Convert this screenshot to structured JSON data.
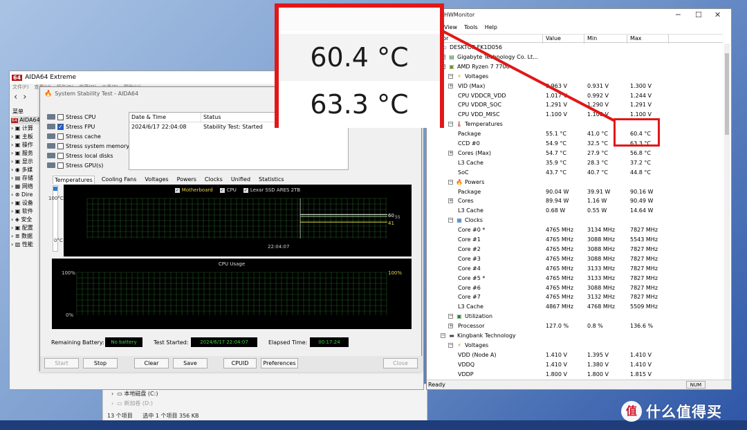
{
  "aida": {
    "title": "AIDA64 Extreme",
    "logo": "64",
    "menu": [
      "文件(F)",
      "查看(V)",
      "报告(R)",
      "收藏(O)",
      "工具(T)",
      "帮助(H)"
    ],
    "sidebar_header": "菜单",
    "tree_root": "AIDA64",
    "tree_items": [
      "计算",
      "主板",
      "操作",
      "服务",
      "显示",
      "多媒",
      "存储",
      "网络",
      "Dire",
      "设备",
      "软件",
      "安全",
      "配置",
      "数据",
      "性能"
    ]
  },
  "sst": {
    "title": "System Stability Test - AIDA64",
    "options": [
      {
        "label": "Stress CPU",
        "checked": false
      },
      {
        "label": "Stress FPU",
        "checked": true
      },
      {
        "label": "Stress cache",
        "checked": false
      },
      {
        "label": "Stress system memory",
        "checked": false
      },
      {
        "label": "Stress local disks",
        "checked": false
      },
      {
        "label": "Stress GPU(s)",
        "checked": false
      }
    ],
    "log_headers": [
      "Date & Time",
      "Status"
    ],
    "log_rows": [
      [
        "2024/6/17 22:04:08",
        "Stability Test: Started"
      ]
    ],
    "tabs": [
      "Temperatures",
      "Cooling Fans",
      "Voltages",
      "Powers",
      "Clocks",
      "Unified",
      "Statistics"
    ],
    "active_tab": "Temperatures",
    "temp_graph": {
      "legend": [
        "Motherboard",
        "CPU",
        "Lexar SSD ARES 2TB"
      ],
      "y_top": "100°C",
      "y_bottom": "0°C",
      "x_label": "22:04:07",
      "right_values": [
        "60",
        "55",
        "41"
      ],
      "series_levels": [
        60,
        55,
        41
      ],
      "line_colors": [
        "#ffffff",
        "#9ec88a",
        "#e8d84a"
      ],
      "start_fraction": 0.71
    },
    "cpu_graph": {
      "title": "CPU Usage",
      "y_top": "100%",
      "y_bottom": "0%",
      "right_value": "100%"
    },
    "remaining_battery_label": "Remaining Battery:",
    "remaining_battery_value": "No battery",
    "test_started_label": "Test Started:",
    "test_started_value": "2024/6/17 22:04:07",
    "elapsed_label": "Elapsed Time:",
    "elapsed_value": "00:17:24",
    "buttons": {
      "start": "Start",
      "stop": "Stop",
      "clear": "Clear",
      "save": "Save",
      "cpuid": "CPUID",
      "preferences": "Preferences",
      "close": "Close"
    }
  },
  "explorer": {
    "tree": [
      "本地磁盘 (C:)",
      "新加卷 (D:)"
    ],
    "status": [
      "13 个项目",
      "选中 1 个项目  356 KB"
    ]
  },
  "hw": {
    "title": "HWMonitor",
    "menu": [
      "View",
      "Tools",
      "Help"
    ],
    "columns": [
      "Sensor",
      "Value",
      "Min",
      "Max"
    ],
    "rows": [
      {
        "d": 0,
        "type": "computer",
        "name": "DESKTOP-FK1D056"
      },
      {
        "d": 1,
        "type": "board",
        "name": "Gigabyte Technology Co. Lt..."
      },
      {
        "d": 1,
        "type": "cpu",
        "name": "AMD Ryzen 7 7700"
      },
      {
        "d": 2,
        "type": "volt",
        "name": "Voltages"
      },
      {
        "d": 3,
        "exp": true,
        "name": "VID (Max)",
        "v": "0.963 V",
        "mn": "0.931 V",
        "mx": "1.300 V"
      },
      {
        "d": 3,
        "name": "CPU VDDCR_VDD",
        "v": "1.017 V",
        "mn": "0.992 V",
        "mx": "1.244 V"
      },
      {
        "d": 3,
        "name": "CPU VDDR_SOC",
        "v": "1.291 V",
        "mn": "1.290 V",
        "mx": "1.291 V"
      },
      {
        "d": 3,
        "name": "CPU VDD_MISC",
        "v": "1.100 V",
        "mn": "1.100 V",
        "mx": "1.100 V"
      },
      {
        "d": 2,
        "type": "temp",
        "name": "Temperatures"
      },
      {
        "d": 3,
        "name": "Package",
        "v": "55.1 °C",
        "mn": "41.0 °C",
        "mx": "60.4 °C"
      },
      {
        "d": 3,
        "name": "CCD #0",
        "v": "54.9 °C",
        "mn": "32.5 °C",
        "mx": "63.3 °C"
      },
      {
        "d": 3,
        "exp": true,
        "name": "Cores (Max)",
        "v": "54.7 °C",
        "mn": "27.9 °C",
        "mx": "56.8 °C"
      },
      {
        "d": 3,
        "name": "L3 Cache",
        "v": "35.9 °C",
        "mn": "28.3 °C",
        "mx": "37.2 °C"
      },
      {
        "d": 3,
        "name": "SoC",
        "v": "43.7 °C",
        "mn": "40.7 °C",
        "mx": "44.8 °C"
      },
      {
        "d": 2,
        "type": "power",
        "name": "Powers"
      },
      {
        "d": 3,
        "name": "Package",
        "v": "90.04 W",
        "mn": "39.91 W",
        "mx": "90.16 W"
      },
      {
        "d": 3,
        "exp": true,
        "name": "Cores",
        "v": "89.94 W",
        "mn": "1.16 W",
        "mx": "90.49 W"
      },
      {
        "d": 3,
        "name": "L3 Cache",
        "v": "0.68 W",
        "mn": "0.55 W",
        "mx": "14.64 W"
      },
      {
        "d": 2,
        "type": "clock",
        "name": "Clocks"
      },
      {
        "d": 3,
        "name": "Core #0 *",
        "v": "4765 MHz",
        "mn": "3134 MHz",
        "mx": "7827 MHz"
      },
      {
        "d": 3,
        "name": "Core #1",
        "v": "4765 MHz",
        "mn": "3088 MHz",
        "mx": "5543 MHz"
      },
      {
        "d": 3,
        "name": "Core #2",
        "v": "4765 MHz",
        "mn": "3088 MHz",
        "mx": "7827 MHz"
      },
      {
        "d": 3,
        "name": "Core #3",
        "v": "4765 MHz",
        "mn": "3088 MHz",
        "mx": "7827 MHz"
      },
      {
        "d": 3,
        "name": "Core #4",
        "v": "4765 MHz",
        "mn": "3133 MHz",
        "mx": "7827 MHz"
      },
      {
        "d": 3,
        "name": "Core #5 *",
        "v": "4765 MHz",
        "mn": "3133 MHz",
        "mx": "7827 MHz"
      },
      {
        "d": 3,
        "name": "Core #6",
        "v": "4765 MHz",
        "mn": "3088 MHz",
        "mx": "7827 MHz"
      },
      {
        "d": 3,
        "name": "Core #7",
        "v": "4765 MHz",
        "mn": "3132 MHz",
        "mx": "7827 MHz"
      },
      {
        "d": 3,
        "name": "L3 Cache",
        "v": "4867 MHz",
        "mn": "4768 MHz",
        "mx": "5509 MHz"
      },
      {
        "d": 2,
        "type": "util",
        "name": "Utilization"
      },
      {
        "d": 3,
        "exp": true,
        "name": "Processor",
        "v": "127.0 %",
        "mn": "0.8 %",
        "mx": "136.6 %"
      },
      {
        "d": 1,
        "type": "ssd",
        "name": "Kingbank Technology"
      },
      {
        "d": 2,
        "type": "volt",
        "name": "Voltages"
      },
      {
        "d": 3,
        "name": "VDD (Node A)",
        "v": "1.410 V",
        "mn": "1.395 V",
        "mx": "1.410 V"
      },
      {
        "d": 3,
        "name": "VDDQ",
        "v": "1.410 V",
        "mn": "1.380 V",
        "mx": "1.410 V"
      },
      {
        "d": 3,
        "name": "VDDP",
        "v": "1.800 V",
        "mn": "1.800 V",
        "mx": "1.815 V"
      }
    ],
    "status_ready": "Ready",
    "status_num": "NUM"
  },
  "callout": {
    "value1": "60.4 °C",
    "value2": "63.3 °C",
    "color": "#e21717"
  },
  "watermark": {
    "text": "什么值得买",
    "glyph": "值"
  }
}
